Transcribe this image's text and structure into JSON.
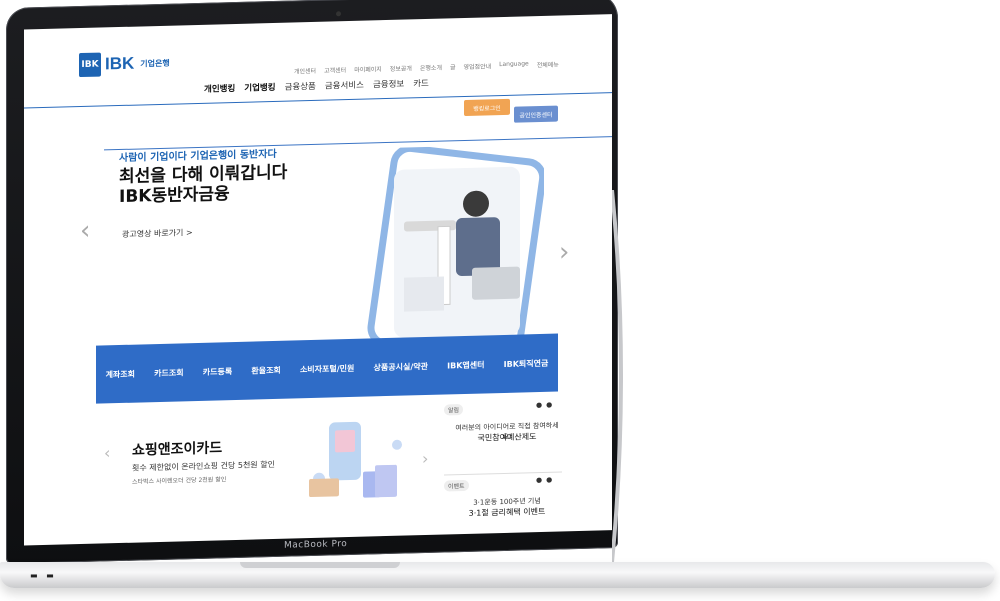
{
  "device": {
    "label": "MacBook Pro"
  },
  "site": {
    "logo_mark": "IBK",
    "logo_text": "IBK",
    "logo_sub": "기업은행",
    "util_links": [
      "개인센터",
      "고객센터",
      "마이페이지",
      "정보공개",
      "은행소개",
      "글",
      "영업점안내",
      "Language",
      "전체메뉴"
    ],
    "main_menu": [
      "개인뱅킹",
      "기업뱅킹",
      "금융상품",
      "금융서비스",
      "금융정보",
      "카드"
    ],
    "btn_login": "뱅킹로그인",
    "btn_cert": "공인인증센터",
    "hero": {
      "sub": "사람이 기업이다 기업은행이 동반자다",
      "title": "최선을 다해 이뤄갑니다 IBK동반자금융",
      "link": "광고영상 바로가기 >",
      "arrow_left": "‹",
      "arrow_right": "›"
    },
    "quick": [
      "계좌조회",
      "카드조회",
      "카드등록",
      "환율조회",
      "소비자포털/민원",
      "상품공시실/약관",
      "IBK앱센터",
      "IBK퇴직연금"
    ],
    "card": {
      "title": "쇼핑앤조이카드",
      "desc": "횟수 제한없이 온라인쇼핑 건당 5천원 할인",
      "sub": "스타벅스 사이렌오더 건당 2천원 할인",
      "prev": "‹",
      "next": "›"
    },
    "notice": {
      "tag": "알림",
      "text1": "여러분의 아이디어로 직접 참여하세요!",
      "text2": "국민참여예산제도",
      "dots": "●●"
    },
    "event": {
      "tag": "이벤트",
      "text1": "3·1운동 100주년 기념",
      "text2": "3·1절 금리혜택 이벤트",
      "dots": "●●"
    }
  },
  "colors": {
    "brand": "#1d64b3",
    "quickbar": "#2f6cc7",
    "login": "#f1a453",
    "cert": "#6a8fd0"
  }
}
